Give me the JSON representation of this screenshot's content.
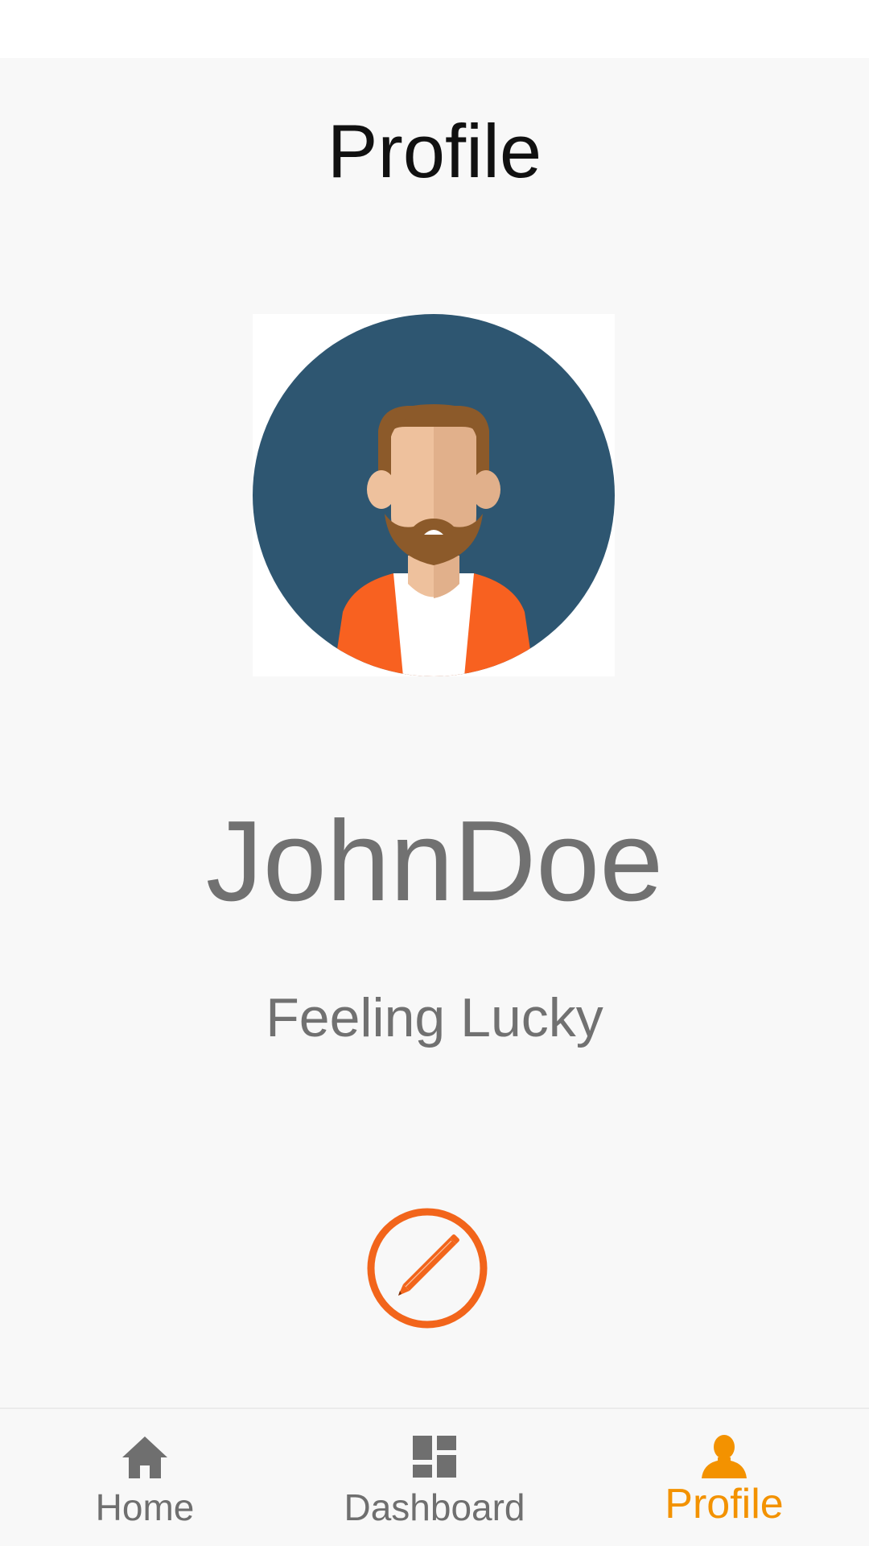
{
  "header": {
    "title": "Profile"
  },
  "profile": {
    "avatar_icon": "bearded-man-avatar",
    "name": "JohnDoe",
    "status": "Feeling Lucky"
  },
  "edit": {
    "icon": "pencil-icon",
    "color": "#F2651B"
  },
  "bottom_nav": {
    "active_color": "#F39200",
    "inactive_color": "#6F6F6F",
    "items": [
      {
        "label": "Home",
        "icon": "home-icon",
        "active": false
      },
      {
        "label": "Dashboard",
        "icon": "dashboard-icon",
        "active": false
      },
      {
        "label": "Profile",
        "icon": "person-icon",
        "active": true
      }
    ]
  }
}
